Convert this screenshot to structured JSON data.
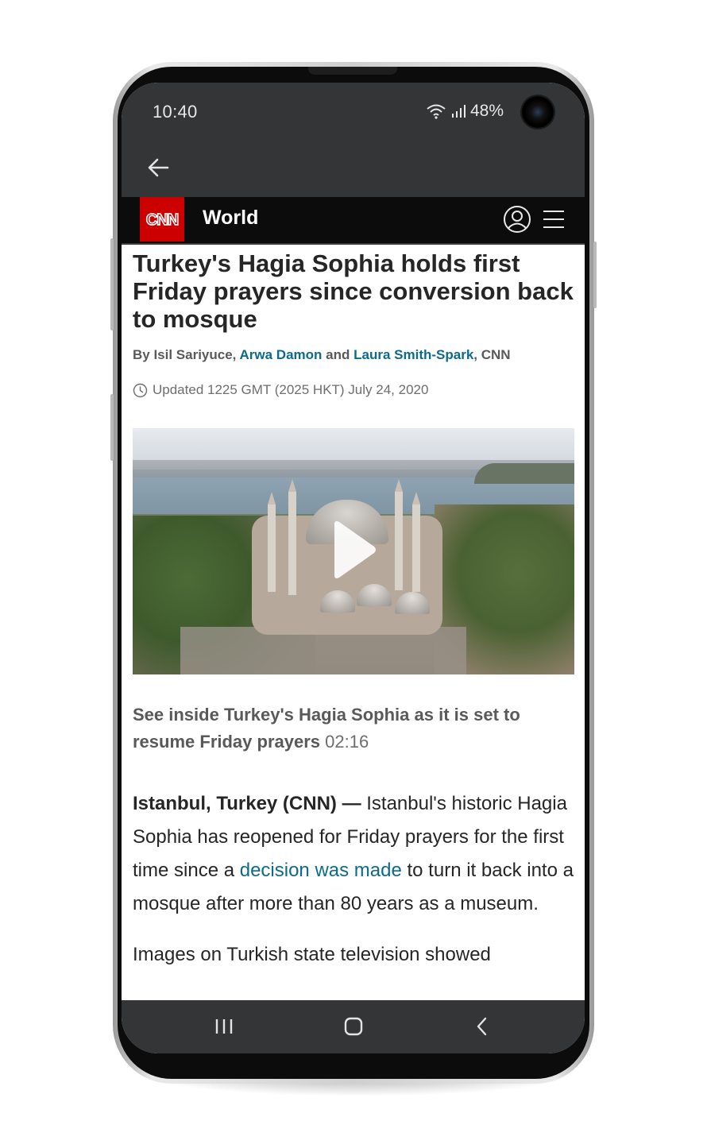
{
  "status_bar": {
    "time": "10:40",
    "battery": "48%",
    "icons": [
      "wifi-icon",
      "signal-icon",
      "front-camera"
    ]
  },
  "app_bar": {
    "back_icon": "arrow-left-icon"
  },
  "cnn_header": {
    "logo_text": "CNN",
    "section": "World",
    "icons": [
      "user-account-icon",
      "hamburger-menu-icon"
    ],
    "logo_color": "#cc0000",
    "background": "#0c0c0c"
  },
  "article": {
    "headline": "Turkey's Hagia Sophia holds first Friday prayers since conversion back to mosque",
    "byline": {
      "prefix": "By Isil Sariyuce,",
      "author_link_1": "Arwa Damon",
      "and": "and",
      "author_link_2": "Laura Smith-Spark",
      "suffix": ", CNN"
    },
    "updated": "Updated 1225 GMT (2025 HKT) July 24, 2020",
    "video": {
      "caption": "See inside Turkey's Hagia Sophia as it is set to resume Friday prayers",
      "duration": "02:16",
      "play_icon": "play-icon"
    },
    "paragraph_1": {
      "dateline": "Istanbul, Turkey (CNN) —",
      "text_before_link": " Istanbul's historic Hagia Sophia has reopened for Friday prayers for the first time since a ",
      "link": "decision was made",
      "text_after_link": " to turn it back into a mosque after more than 80 years as a museum."
    },
    "paragraph_2": "Images on Turkish state television showed",
    "link_color": "#0c6b8c"
  },
  "nav_bar": {
    "icons": [
      "recent-apps-icon",
      "home-icon",
      "back-icon"
    ]
  }
}
